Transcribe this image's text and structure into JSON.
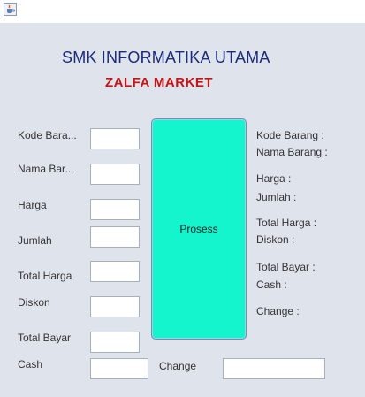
{
  "window": {
    "icon": "java-coffee-icon"
  },
  "header": {
    "title": "SMK INFORMATIKA UTAMA",
    "subtitle": "ZALFA MARKET"
  },
  "form": {
    "kode_barang_label": "Kode Bara...",
    "nama_barang_label": "Nama Bar...",
    "harga_label": "Harga",
    "jumlah_label": "Jumlah",
    "total_harga_label": "Total Harga",
    "diskon_label": "Diskon",
    "total_bayar_label": "Total Bayar",
    "cash_label": "Cash",
    "change_label": "Change",
    "kode_barang_value": "",
    "nama_barang_value": "",
    "harga_value": "",
    "jumlah_value": "",
    "total_harga_value": "",
    "diskon_value": "",
    "total_bayar_value": "",
    "cash_value": "",
    "change_value": ""
  },
  "actions": {
    "prosess_label": "Prosess"
  },
  "output": {
    "kode_barang": "Kode Barang :",
    "nama_barang": "Nama Barang :",
    "harga": "Harga :",
    "jumlah": "Jumlah :",
    "total_harga": "Total Harga :",
    "diskon": "Diskon :",
    "total_bayar": "Total Bayar :",
    "cash": "Cash :",
    "change": "Change :"
  },
  "colors": {
    "background": "#dfe3ec",
    "title": "#1b2a7a",
    "subtitle": "#c41414",
    "button": "#14f5cd"
  }
}
